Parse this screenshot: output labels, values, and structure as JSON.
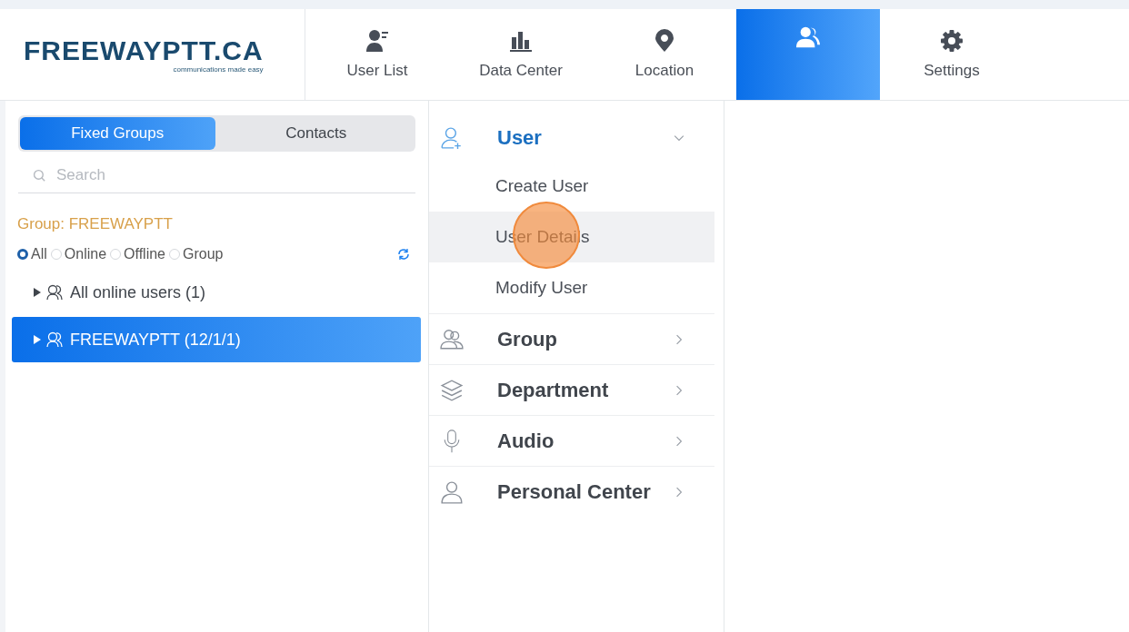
{
  "logo": {
    "name": "FREEWAYPTT.CA",
    "tagline": "communications made easy"
  },
  "nav": [
    {
      "label": "User List",
      "selected": false
    },
    {
      "label": "Data Center",
      "selected": false
    },
    {
      "label": "Location",
      "selected": false
    },
    {
      "selected": true
    },
    {
      "label": "Settings",
      "selected": false
    }
  ],
  "group_tabs": [
    {
      "label": "Fixed Groups",
      "selected": true
    },
    {
      "label": "Contacts",
      "selected": false
    }
  ],
  "search": {
    "placeholder": "Search"
  },
  "group_label": "Group: FREEWAYPTT",
  "filters": [
    {
      "label": "All",
      "selected": true
    },
    {
      "label": "Online",
      "selected": false
    },
    {
      "label": "Offline",
      "selected": false
    },
    {
      "label": "Group",
      "selected": false
    }
  ],
  "tree": [
    {
      "label": "All online users (1)",
      "selected": false,
      "expanded": false
    },
    {
      "label": "FREEWAYPTT (12/1/1)",
      "selected": true,
      "expanded": false
    }
  ],
  "menu": [
    {
      "label": "User",
      "selected": true,
      "expanded": true,
      "children": [
        {
          "label": "Create User",
          "selected": false
        },
        {
          "label": "User Details",
          "selected": true
        },
        {
          "label": "Modify User",
          "selected": false
        }
      ]
    },
    {
      "label": "Group",
      "selected": false,
      "expanded": false
    },
    {
      "label": "Department",
      "selected": false,
      "expanded": false
    },
    {
      "label": "Audio",
      "selected": false,
      "expanded": false
    },
    {
      "label": "Personal Center",
      "selected": false,
      "expanded": false
    }
  ]
}
